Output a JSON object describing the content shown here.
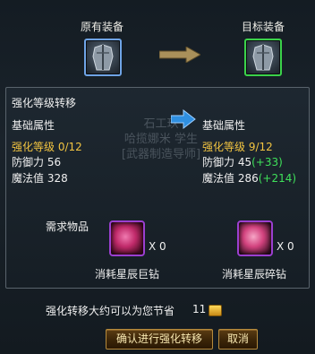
{
  "header": {
    "original_label": "原有装备",
    "target_label": "目标装备"
  },
  "panel": {
    "title": "强化等级转移",
    "watermark_lines": [
      "石工玖",
      "哈揽娜米 学生",
      "[武器制造导师]"
    ],
    "left": {
      "section": "基础属性",
      "level_label": "强化等级",
      "level_value": "0/12",
      "defense_label": "防御力",
      "defense_value": "56",
      "magic_label": "魔法值",
      "magic_value": "328"
    },
    "right": {
      "section": "基础属性",
      "level_label": "强化等级",
      "level_value": "9/12",
      "defense_label": "防御力",
      "defense_value": "45",
      "defense_delta": "(+33)",
      "magic_label": "魔法值",
      "magic_value": "286",
      "magic_delta": "(+214)"
    },
    "requirements_label": "需求物品",
    "items": [
      {
        "name": "消耗星辰巨钻",
        "count": "X 0",
        "icon": "star-giant-diamond-icon"
      },
      {
        "name": "消耗星辰碎钻",
        "count": "X 0",
        "icon": "star-shard-diamond-icon"
      }
    ]
  },
  "footer": {
    "savings_text": "强化转移大约可以为您节省",
    "savings_value": "11",
    "confirm_label": "确认进行强化转移",
    "cancel_label": "取消"
  },
  "colors": {
    "gold": "#f2c441",
    "green": "#3fe05a",
    "slot_blue": "#6fa4e6",
    "slot_green": "#3bd24a"
  }
}
